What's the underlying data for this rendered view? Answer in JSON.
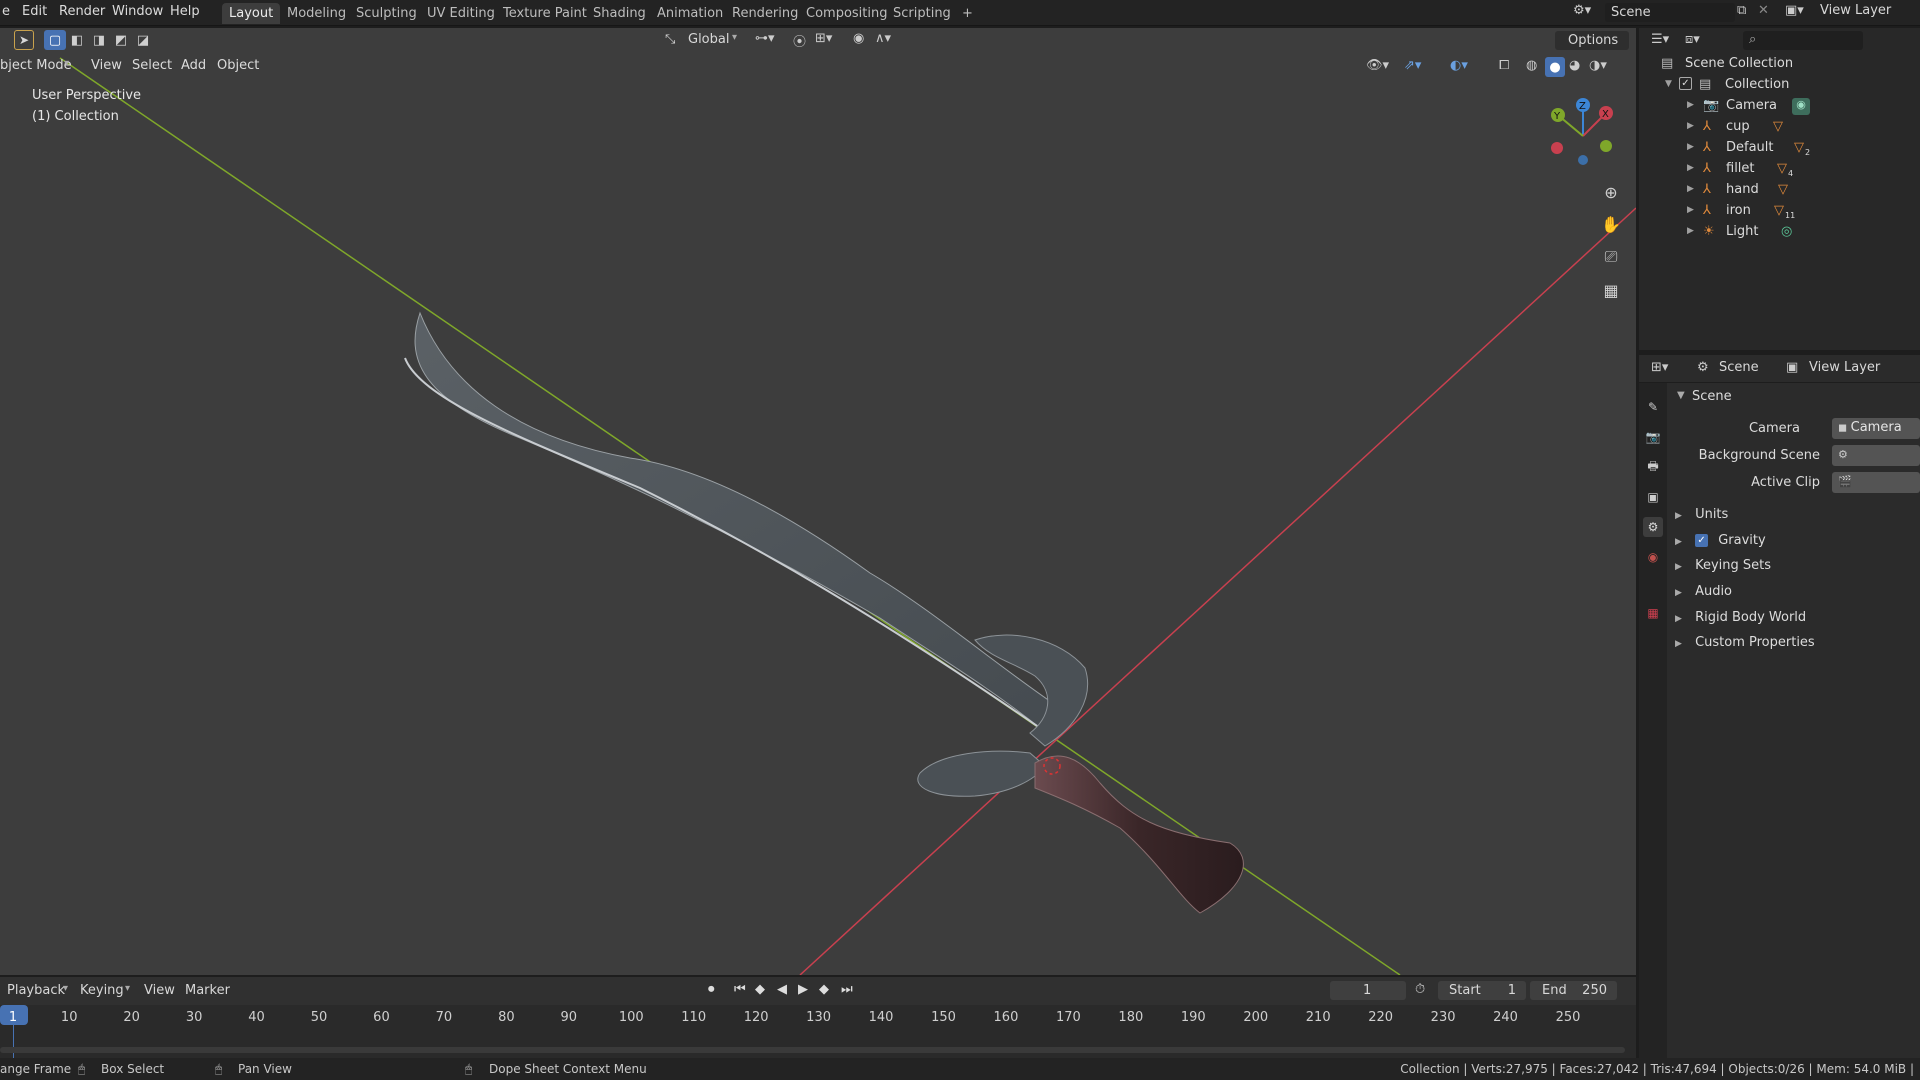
{
  "menu": [
    "e",
    "Edit",
    "Render",
    "Window",
    "Help"
  ],
  "workspaces": [
    {
      "label": "Layout",
      "active": true
    },
    {
      "label": "Modeling"
    },
    {
      "label": "Sculpting"
    },
    {
      "label": "UV Editing"
    },
    {
      "label": "Texture Paint"
    },
    {
      "label": "Shading"
    },
    {
      "label": "Animation"
    },
    {
      "label": "Rendering"
    },
    {
      "label": "Compositing"
    },
    {
      "label": "Scripting"
    },
    {
      "label": "+"
    }
  ],
  "scene_selector": "Scene",
  "view_layer_selector": "View Layer",
  "viewport": {
    "mode": "bject Mode",
    "menus": [
      "View",
      "Select",
      "Add",
      "Object"
    ],
    "transform_orientation": "Global",
    "options_label": "Options",
    "overlay_line1": "User Perspective",
    "overlay_line2": "(1) Collection",
    "gizmo_axes": {
      "z": "Z",
      "y": "Y",
      "x": "X"
    }
  },
  "outliner": {
    "root": "Scene Collection",
    "collection": "Collection",
    "items": [
      {
        "name": "Camera",
        "icon": "camera-icon"
      },
      {
        "name": "cup",
        "icon": "mesh-icon"
      },
      {
        "name": "Default",
        "icon": "mesh-icon",
        "badge": "2"
      },
      {
        "name": "fillet",
        "icon": "mesh-icon",
        "badge": "4"
      },
      {
        "name": "hand",
        "icon": "mesh-icon"
      },
      {
        "name": "iron",
        "icon": "mesh-icon",
        "badge": "11"
      },
      {
        "name": "Light",
        "icon": "light-icon"
      }
    ]
  },
  "properties": {
    "header_scene": "Scene",
    "header_view_layer": "View Layer",
    "panel_title": "Scene",
    "camera_label": "Camera",
    "camera_value": "Camera",
    "background_label": "Background Scene",
    "active_clip_label": "Active Clip",
    "subpanels": [
      "Units",
      "Gravity",
      "Keying Sets",
      "Audio",
      "Rigid Body World",
      "Custom Properties"
    ]
  },
  "timeline": {
    "menus": [
      "Playback",
      "Keying",
      "View",
      "Marker"
    ],
    "current_frame": "1",
    "start_label": "Start",
    "start_value": "1",
    "end_label": "End",
    "end_value": "250",
    "ticks": [
      "1",
      "10",
      "20",
      "30",
      "40",
      "50",
      "60",
      "70",
      "80",
      "90",
      "100",
      "110",
      "120",
      "130",
      "140",
      "150",
      "160",
      "170",
      "180",
      "190",
      "200",
      "210",
      "220",
      "230",
      "240",
      "250"
    ]
  },
  "status": {
    "left1": "ange Frame",
    "left2": "Box Select",
    "left3": "Pan View",
    "left4": "Dope Sheet Context Menu",
    "right": "Collection | Verts:27,975 | Faces:27,042 | Tris:47,694 | Objects:0/26 | Mem: 54.0 MiB |"
  },
  "colors": {
    "accent": "#4772b3",
    "x_axis": "#c8404f",
    "y_axis": "#7fa72a",
    "z_axis": "#3c86d6"
  }
}
